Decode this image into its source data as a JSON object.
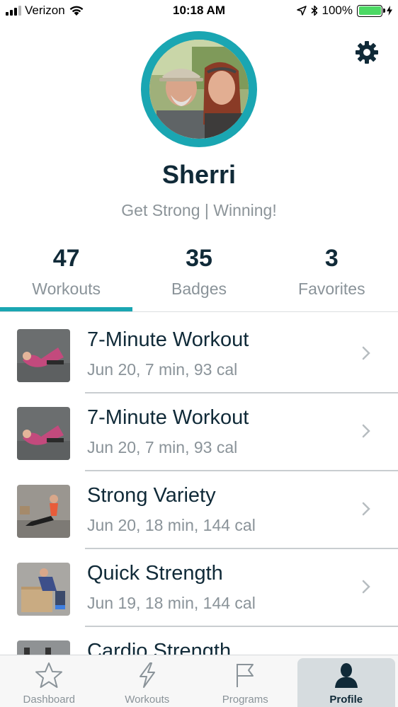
{
  "status_bar": {
    "carrier": "Verizon",
    "time": "10:18 AM",
    "battery_percent": "100%",
    "battery_level": 1.0
  },
  "profile": {
    "name": "Sherri",
    "motto": "Get Strong | Winning!",
    "ring_color": "#1aa6b2"
  },
  "stats": [
    {
      "value": "47",
      "label": "Workouts"
    },
    {
      "value": "35",
      "label": "Badges"
    },
    {
      "value": "3",
      "label": "Favorites"
    }
  ],
  "workouts": [
    {
      "title": "7-Minute Workout",
      "meta": "Jun 20, 7 min, 93 cal"
    },
    {
      "title": "7-Minute Workout",
      "meta": "Jun 20, 7 min, 93 cal"
    },
    {
      "title": "Strong Variety",
      "meta": "Jun 20, 18 min, 144 cal"
    },
    {
      "title": "Quick Strength",
      "meta": "Jun 19, 18 min, 144 cal"
    },
    {
      "title": "Cardio Strength",
      "meta": ""
    }
  ],
  "tabs": [
    {
      "label": "Dashboard",
      "icon": "star-icon"
    },
    {
      "label": "Workouts",
      "icon": "lightning-icon"
    },
    {
      "label": "Programs",
      "icon": "flag-icon"
    },
    {
      "label": "Profile",
      "icon": "person-icon"
    }
  ],
  "colors": {
    "accent": "#1aa6b2",
    "text_dark": "#102a38",
    "text_muted": "#8a9399"
  }
}
